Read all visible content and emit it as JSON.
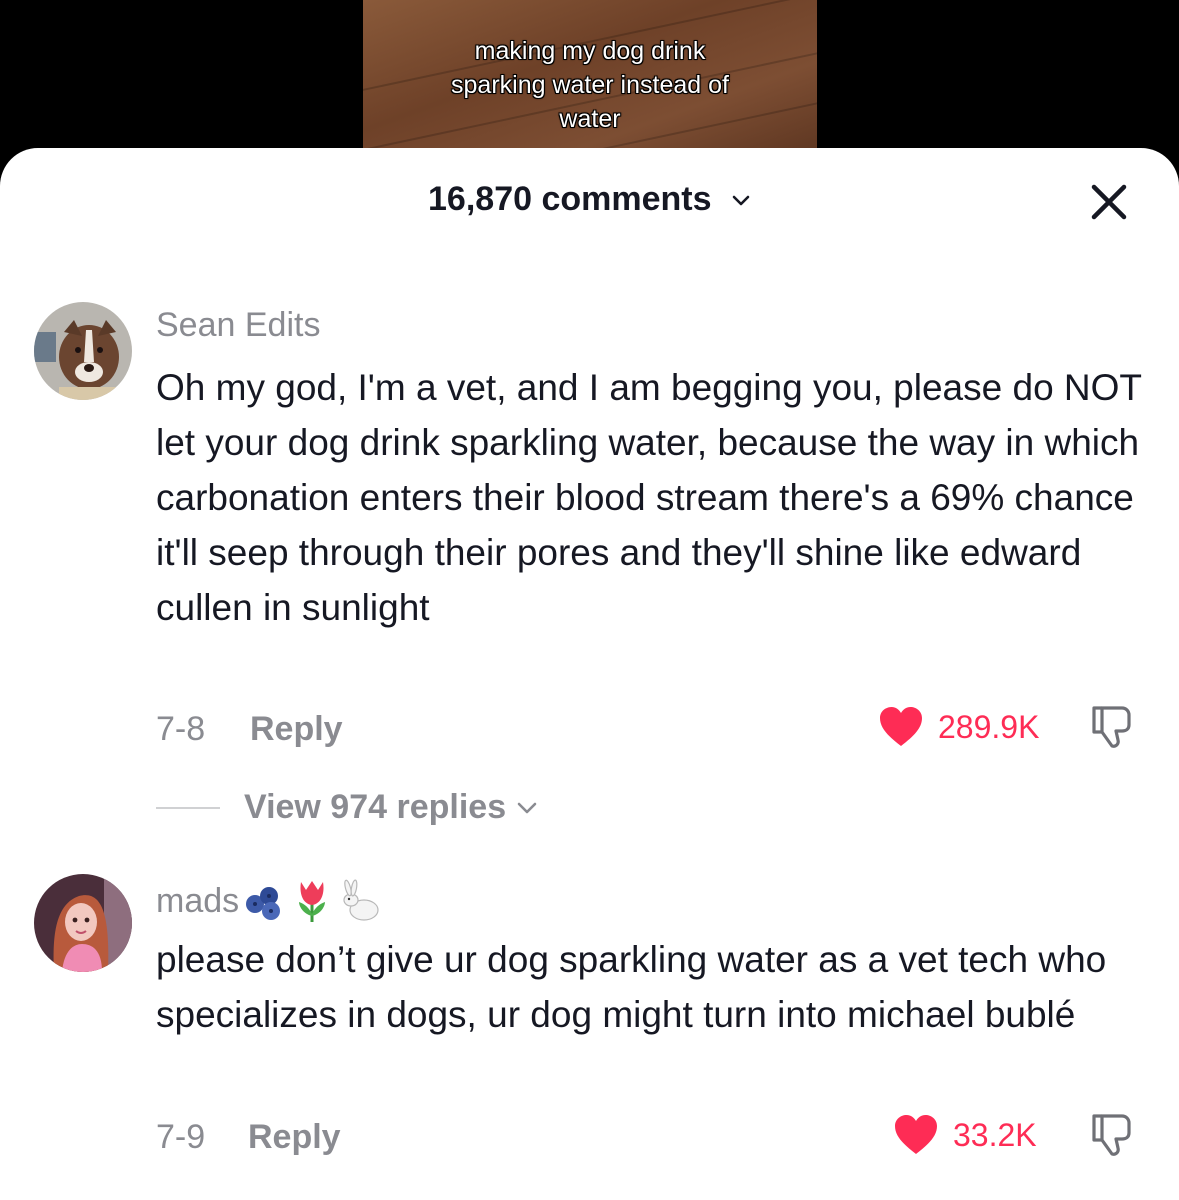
{
  "video": {
    "caption_lines": [
      "making my dog drink",
      "sparking water instead of",
      "water"
    ]
  },
  "sheet": {
    "comment_count_label": "16,870 comments"
  },
  "comments": [
    {
      "username": "Sean Edits",
      "text": "Oh my god, I'm a vet, and I am begging you, please do NOT let your dog drink sparkling water, because the way in which carbonation enters their blood stream there's a 69% chance it'll seep through their pores and they'll shine like edward cullen in sunlight",
      "date": "7-8",
      "reply_label": "Reply",
      "likes": "289.9K",
      "view_replies_label": "View 974 replies"
    },
    {
      "username": "mads",
      "username_emojis": [
        "blueberries-icon",
        "tulip-icon",
        "rabbit-icon"
      ],
      "text": "please don’t give ur dog sparkling water as a vet tech who specializes in dogs, ur dog might turn into michael bublé",
      "date": "7-9",
      "reply_label": "Reply",
      "likes": "33.2K"
    }
  ],
  "colors": {
    "like_accent": "#fe2c55",
    "muted_text": "#8a8b91",
    "primary_text": "#161823"
  }
}
